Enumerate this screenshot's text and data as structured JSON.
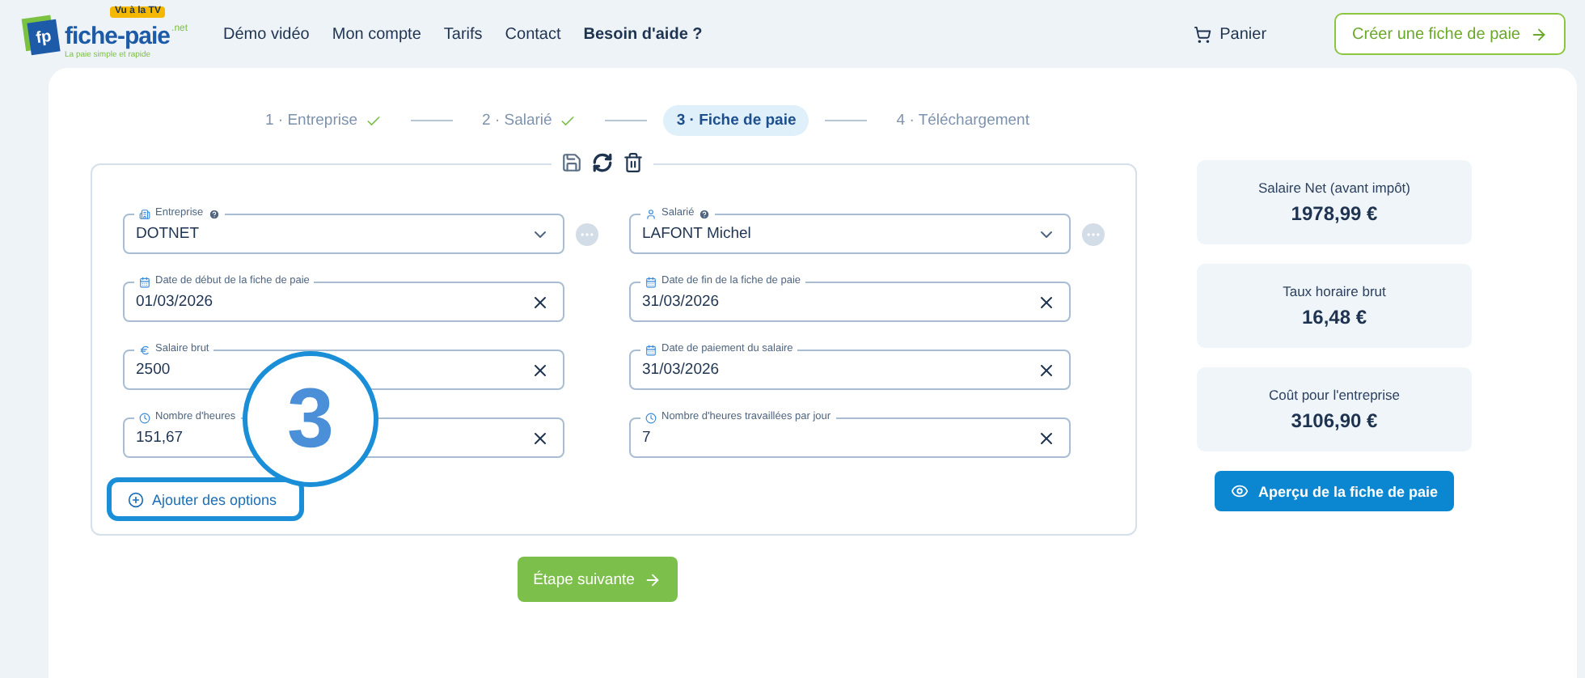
{
  "header": {
    "logo": {
      "badge": "Vu à la TV",
      "initials": "fp",
      "name": "fiche-paie",
      "suffix": ".net",
      "tagline": "La paie simple et rapide"
    },
    "nav": [
      {
        "label": "Démo vidéo",
        "emphasis": false
      },
      {
        "label": "Mon compte",
        "emphasis": false
      },
      {
        "label": "Tarifs",
        "emphasis": false
      },
      {
        "label": "Contact",
        "emphasis": false
      },
      {
        "label": "Besoin d'aide ?",
        "emphasis": true
      }
    ],
    "cart": "Panier",
    "cta": "Créer une fiche de paie"
  },
  "steps": [
    {
      "label": "1 · Entreprise",
      "done": true,
      "selected": false
    },
    {
      "label": "2 · Salarié",
      "done": true,
      "selected": false
    },
    {
      "label": "3 · Fiche de paie",
      "done": false,
      "selected": true
    },
    {
      "label": "4 · Téléchargement",
      "done": false,
      "selected": false
    }
  ],
  "fields": [
    {
      "kind": "company",
      "label": "Entreprise",
      "help": true,
      "value": "DOTNET",
      "more": true
    },
    {
      "kind": "employee",
      "label": "Salarié",
      "help": true,
      "value": "LAFONT Michel",
      "more": true
    },
    {
      "kind": "date",
      "label": "Date de début de la fiche de paie",
      "help": false,
      "value": "01/03/2026",
      "more": false
    },
    {
      "kind": "date",
      "label": "Date de fin de la fiche de paie",
      "help": false,
      "value": "31/03/2026",
      "more": false
    },
    {
      "kind": "amount",
      "label": "Salaire brut",
      "help": false,
      "value": "2500",
      "more": false
    },
    {
      "kind": "date",
      "label": "Date de paiement du salaire",
      "help": false,
      "value": "31/03/2026",
      "more": false
    },
    {
      "kind": "hours",
      "label": "Nombre d'heures",
      "help": false,
      "value": "151,67",
      "more": false
    },
    {
      "kind": "hours",
      "label": "Nombre d'heures travaillées par jour",
      "help": false,
      "value": "7",
      "more": false
    }
  ],
  "add_options": {
    "label": "Ajouter des options",
    "highlighted": true
  },
  "callout": {
    "label": "3"
  },
  "summary": [
    {
      "label": "Salaire Net (avant impôt)",
      "value": "1978,99 €"
    },
    {
      "label": "Taux horaire brut",
      "value": "16,48 €"
    },
    {
      "label": "Coût pour l'entreprise",
      "value": "3106,90 €"
    }
  ],
  "preview_button": "Aperçu de la fiche de paie",
  "next_button": "Étape suivante"
}
